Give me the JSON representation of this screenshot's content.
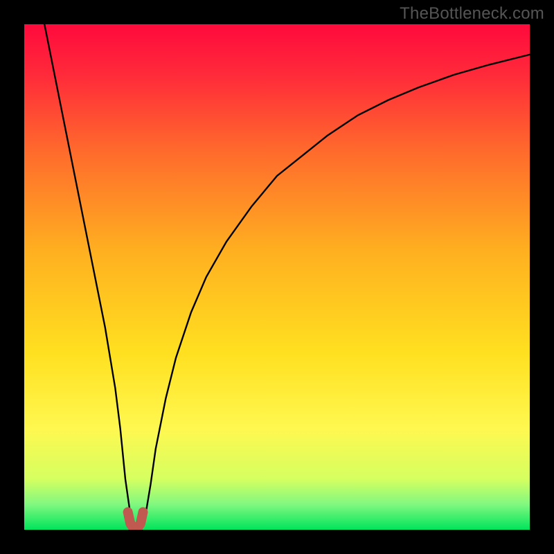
{
  "watermark": "TheBottleneck.com",
  "chart_data": {
    "type": "line",
    "title": "",
    "xlabel": "",
    "ylabel": "",
    "xlim": [
      0,
      100
    ],
    "ylim": [
      0,
      100
    ],
    "grid": false,
    "legend": false,
    "background_gradient_top": "#ff0a3c",
    "background_gradient_mid": "#ffd200",
    "background_gradient_low": "#ffff66",
    "background_gradient_bottom": "#00e45a",
    "optimal_x": 22,
    "series": [
      {
        "name": "bottleneck-curve",
        "color": "#000000",
        "x": [
          4,
          6,
          8,
          10,
          12,
          14,
          16,
          18,
          19,
          20,
          21,
          22,
          23,
          24,
          25,
          26,
          28,
          30,
          33,
          36,
          40,
          45,
          50,
          55,
          60,
          66,
          72,
          78,
          85,
          92,
          100
        ],
        "y": [
          100,
          90,
          80,
          70,
          60,
          50,
          40,
          28,
          20,
          10,
          3,
          1,
          1,
          3,
          9,
          16,
          26,
          34,
          43,
          50,
          57,
          64,
          70,
          74,
          78,
          82,
          85,
          87.5,
          90,
          92,
          94
        ]
      },
      {
        "name": "optimal-marker",
        "color": "#c05a50",
        "marker": "round-cap",
        "x": [
          20.5,
          21,
          21.5,
          22,
          22.5,
          23,
          23.5
        ],
        "y": [
          3.5,
          1.2,
          0.5,
          0.4,
          0.5,
          1.2,
          3.5
        ]
      }
    ]
  }
}
